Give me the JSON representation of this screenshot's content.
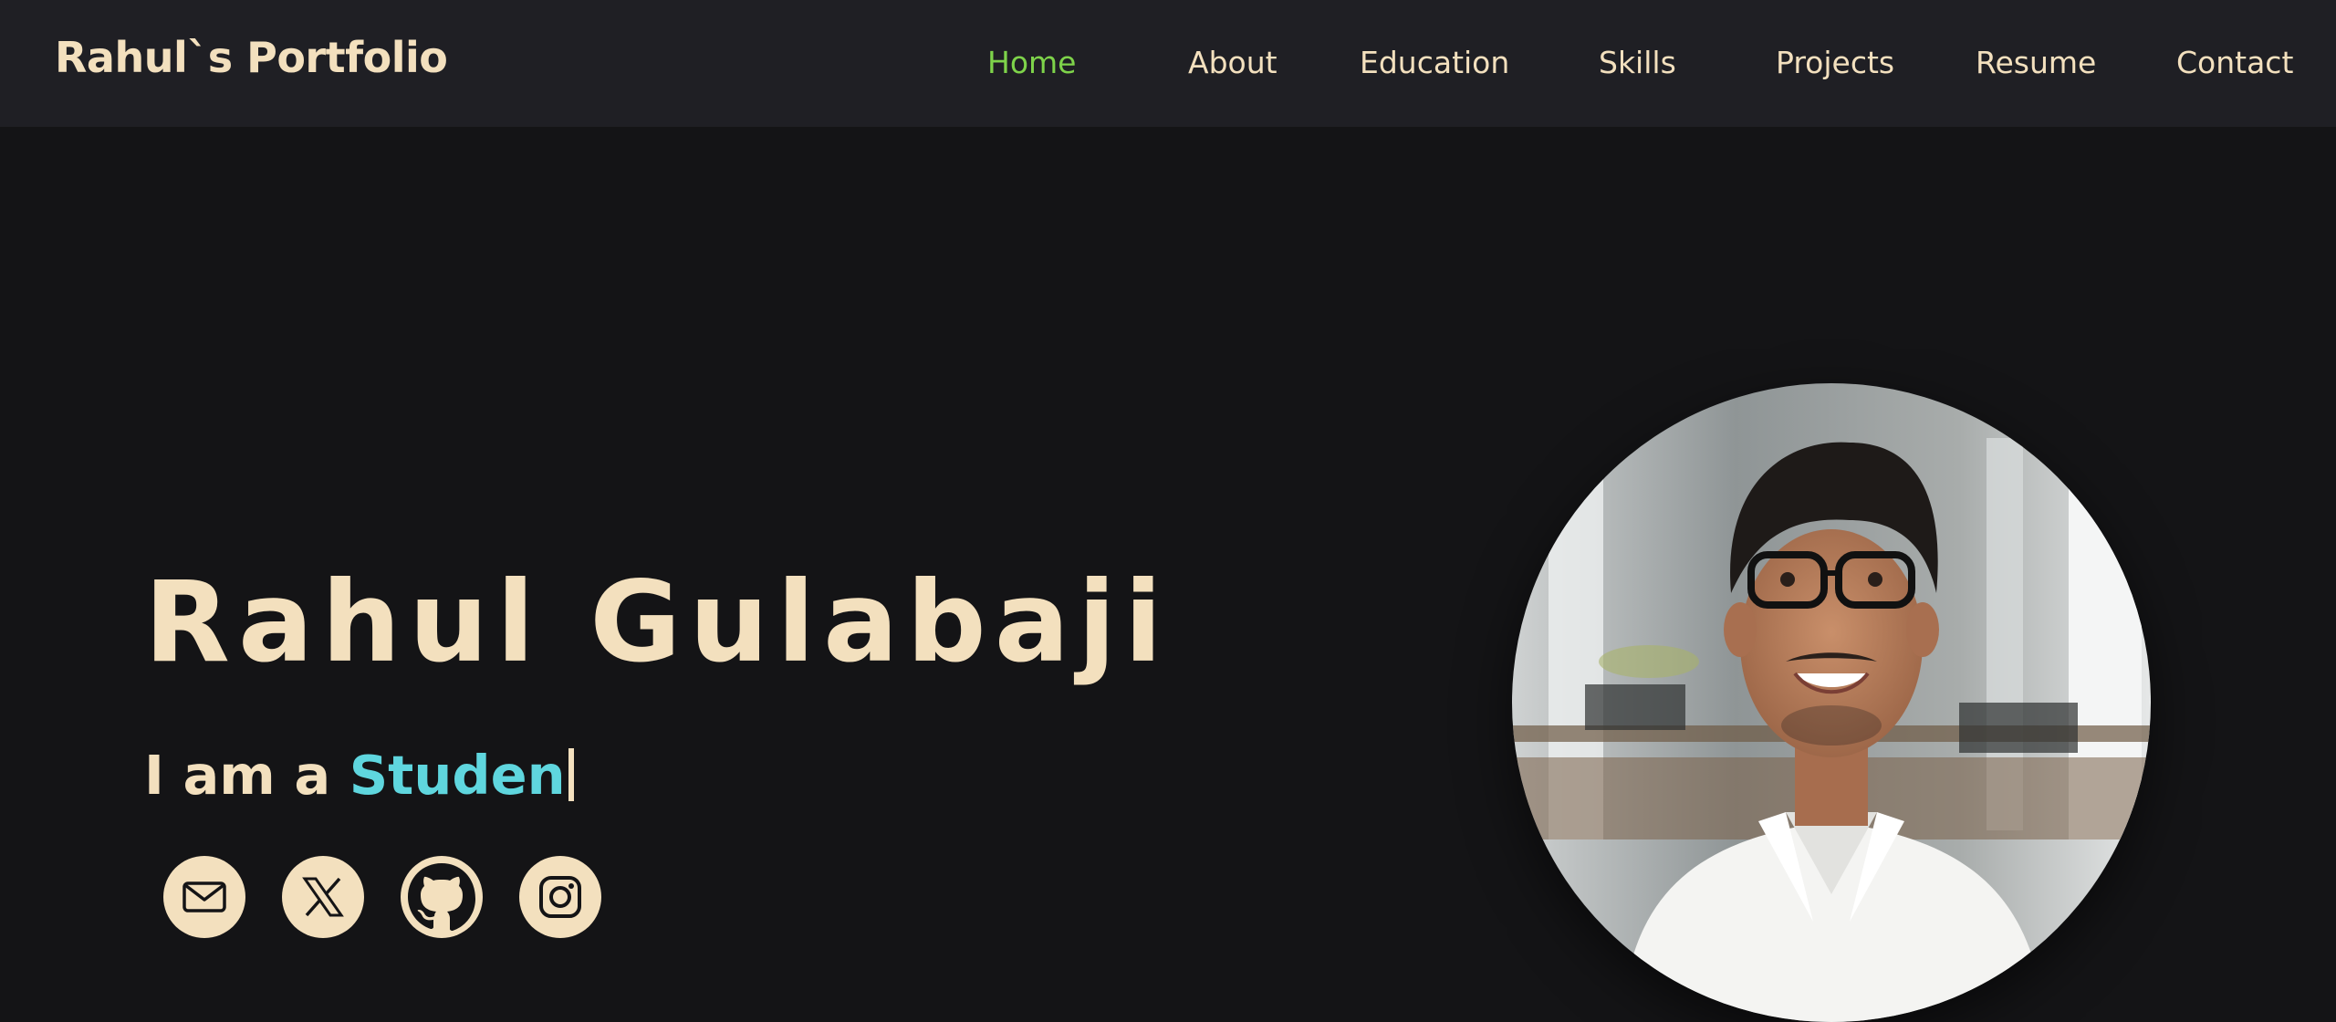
{
  "header": {
    "brand": "Rahul`s Portfolio",
    "nav": [
      {
        "label": "Home",
        "active": true
      },
      {
        "label": "About"
      },
      {
        "label": "Education"
      },
      {
        "label": "Skills"
      },
      {
        "label": "Projects"
      },
      {
        "label": "Resume"
      },
      {
        "label": "Contact"
      }
    ]
  },
  "hero": {
    "name": "Rahul Gulabaji",
    "tagline_prefix": "I am a ",
    "tagline_typed": "Studen",
    "social": [
      {
        "name": "email",
        "icon": "envelope-icon"
      },
      {
        "name": "x",
        "icon": "x-logo-icon"
      },
      {
        "name": "github",
        "icon": "github-icon"
      },
      {
        "name": "instagram",
        "icon": "instagram-icon"
      }
    ],
    "profile_image": "portrait-photo"
  },
  "colors": {
    "background": "#141416",
    "navbar": "#1f1f24",
    "text": "#f3e0be",
    "active_link": "#7ed34a",
    "typed_text": "#5fd6de"
  }
}
